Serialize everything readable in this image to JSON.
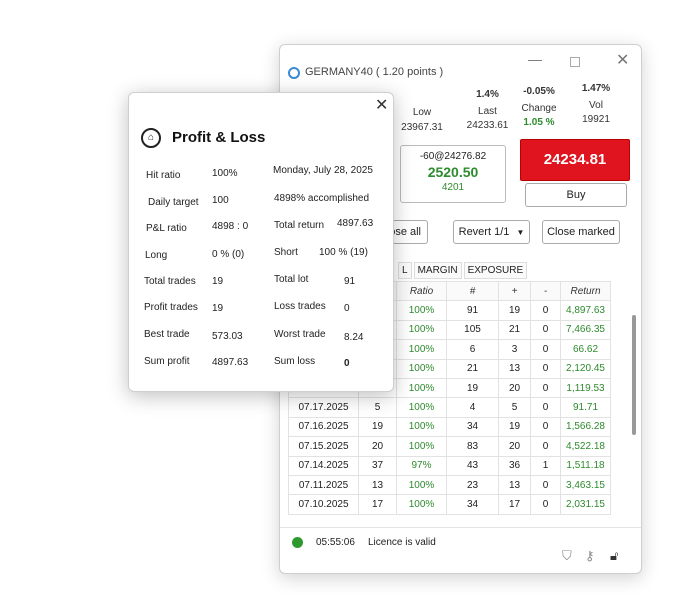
{
  "main": {
    "title": "GERMANY40 ( 1.20 points )",
    "stats": {
      "low_label": "Low",
      "low_value": "23967.31",
      "last_pct": "1.4%",
      "last_label": "Last",
      "last_value": "24233.61",
      "change_top": "-0.05%",
      "change_label": "Change",
      "change_value": "1.05 %",
      "vol_top": "1.47%",
      "vol_label": "Vol",
      "vol_value": "19921"
    },
    "mid_box": {
      "top": "-60@24276.82",
      "big": "2520.50",
      "bottom": "4201"
    },
    "ask_price": "24234.81",
    "buy_label": "Buy",
    "close_all_label": "ose all",
    "revert_label": "Revert 1/1",
    "close_marked_label": "Close marked",
    "tabs": [
      "L",
      "MARGIN",
      "EXPOSURE"
    ],
    "table": {
      "headers": [
        "",
        "",
        "Ratio",
        "#",
        "+",
        "-",
        "Return"
      ],
      "rows": [
        [
          "",
          "",
          "100%",
          "91",
          "19",
          "0",
          "4,897.63"
        ],
        [
          "",
          "",
          "100%",
          "105",
          "21",
          "0",
          "7,466.35"
        ],
        [
          "",
          "",
          "100%",
          "6",
          "3",
          "0",
          "66.62"
        ],
        [
          "",
          "",
          "100%",
          "21",
          "13",
          "0",
          "2,120.45"
        ],
        [
          "",
          "",
          "100%",
          "19",
          "20",
          "0",
          "1,119.53"
        ],
        [
          "07.17.2025",
          "5",
          "100%",
          "4",
          "5",
          "0",
          "91.71"
        ],
        [
          "07.16.2025",
          "19",
          "100%",
          "34",
          "19",
          "0",
          "1,566.28"
        ],
        [
          "07.15.2025",
          "20",
          "100%",
          "83",
          "20",
          "0",
          "4,522.18"
        ],
        [
          "07.14.2025",
          "37",
          "97%",
          "43",
          "36",
          "1",
          "1,511.18"
        ],
        [
          "07.11.2025",
          "13",
          "100%",
          "23",
          "13",
          "0",
          "3,463.15"
        ],
        [
          "07.10.2025",
          "17",
          "100%",
          "34",
          "17",
          "0",
          "2,031.15"
        ]
      ]
    },
    "status": {
      "time": "05:55:06",
      "licence": "Licence is valid"
    }
  },
  "pl": {
    "title": "Profit & Loss",
    "hit_ratio_label": "Hit ratio",
    "hit_ratio_value": "100%",
    "date": "Monday, July 28, 2025",
    "daily_target_label": "Daily target",
    "daily_target_value": "100",
    "accomplished": "4898% accomplished",
    "pl_ratio_label": "P&L ratio",
    "pl_ratio_value": "4898 : 0",
    "total_return_label": "Total return",
    "total_return_value": "4897.63",
    "long_label": "Long",
    "long_value": "0 % (0)",
    "short_label": "Short",
    "short_value": "100 % (19)",
    "total_trades_label": "Total trades",
    "total_trades_value": "19",
    "total_lot_label": "Total lot",
    "total_lot_value": "91",
    "profit_trades_label": "Profit trades",
    "profit_trades_value": "19",
    "loss_trades_label": "Loss trades",
    "loss_trades_value": "0",
    "best_trade_label": "Best trade",
    "best_trade_value": "573.03",
    "worst_trade_label": "Worst trade",
    "worst_trade_value": "8.24",
    "sum_profit_label": "Sum profit",
    "sum_profit_value": "4897.63",
    "sum_loss_label": "Sum loss",
    "sum_loss_value": "0"
  },
  "colors": {
    "green": "#2e8b2e",
    "ask_red": "#e0141e",
    "accent_blue": "#3a8ad6"
  }
}
